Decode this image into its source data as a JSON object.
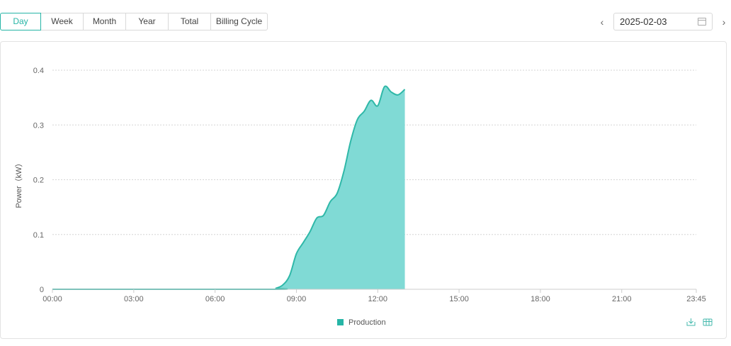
{
  "tabs": [
    "Day",
    "Week",
    "Month",
    "Year",
    "Total",
    "Billing Cycle"
  ],
  "active_tab": "Day",
  "date_picker": {
    "value": "2025-02-03",
    "prev_icon": "chevron-left-icon",
    "next_icon": "chevron-right-icon",
    "calendar_icon": "calendar-icon"
  },
  "toolbar_icons": [
    "download-icon",
    "table-view-icon"
  ],
  "colors": {
    "accent": "#26b5a6",
    "fill": "#80dad5",
    "line": "#2fb8a8"
  },
  "chart_data": {
    "type": "area",
    "ylabel": "Power（kW）",
    "ylim": [
      0,
      0.4
    ],
    "yticks": [
      "0",
      "0.1",
      "0.2",
      "0.3",
      "0.4"
    ],
    "xticks": [
      "00:00",
      "03:00",
      "06:00",
      "09:00",
      "12:00",
      "15:00",
      "18:00",
      "21:00",
      "23:45"
    ],
    "xrange_hours": [
      0,
      23.75
    ],
    "grid": true,
    "legend": "bottom-center",
    "series": [
      {
        "name": "Production",
        "x": [
          "00:00",
          "08:00",
          "08:15",
          "08:30",
          "08:45",
          "09:00",
          "09:15",
          "09:30",
          "09:45",
          "10:00",
          "10:15",
          "10:30",
          "10:45",
          "11:00",
          "11:15",
          "11:30",
          "11:45",
          "12:00",
          "12:15",
          "12:30",
          "12:45",
          "13:00"
        ],
        "values": [
          0,
          0,
          0.002,
          0.008,
          0.025,
          0.065,
          0.085,
          0.105,
          0.13,
          0.135,
          0.16,
          0.175,
          0.215,
          0.27,
          0.31,
          0.325,
          0.345,
          0.335,
          0.37,
          0.36,
          0.355,
          0.365
        ]
      }
    ]
  }
}
